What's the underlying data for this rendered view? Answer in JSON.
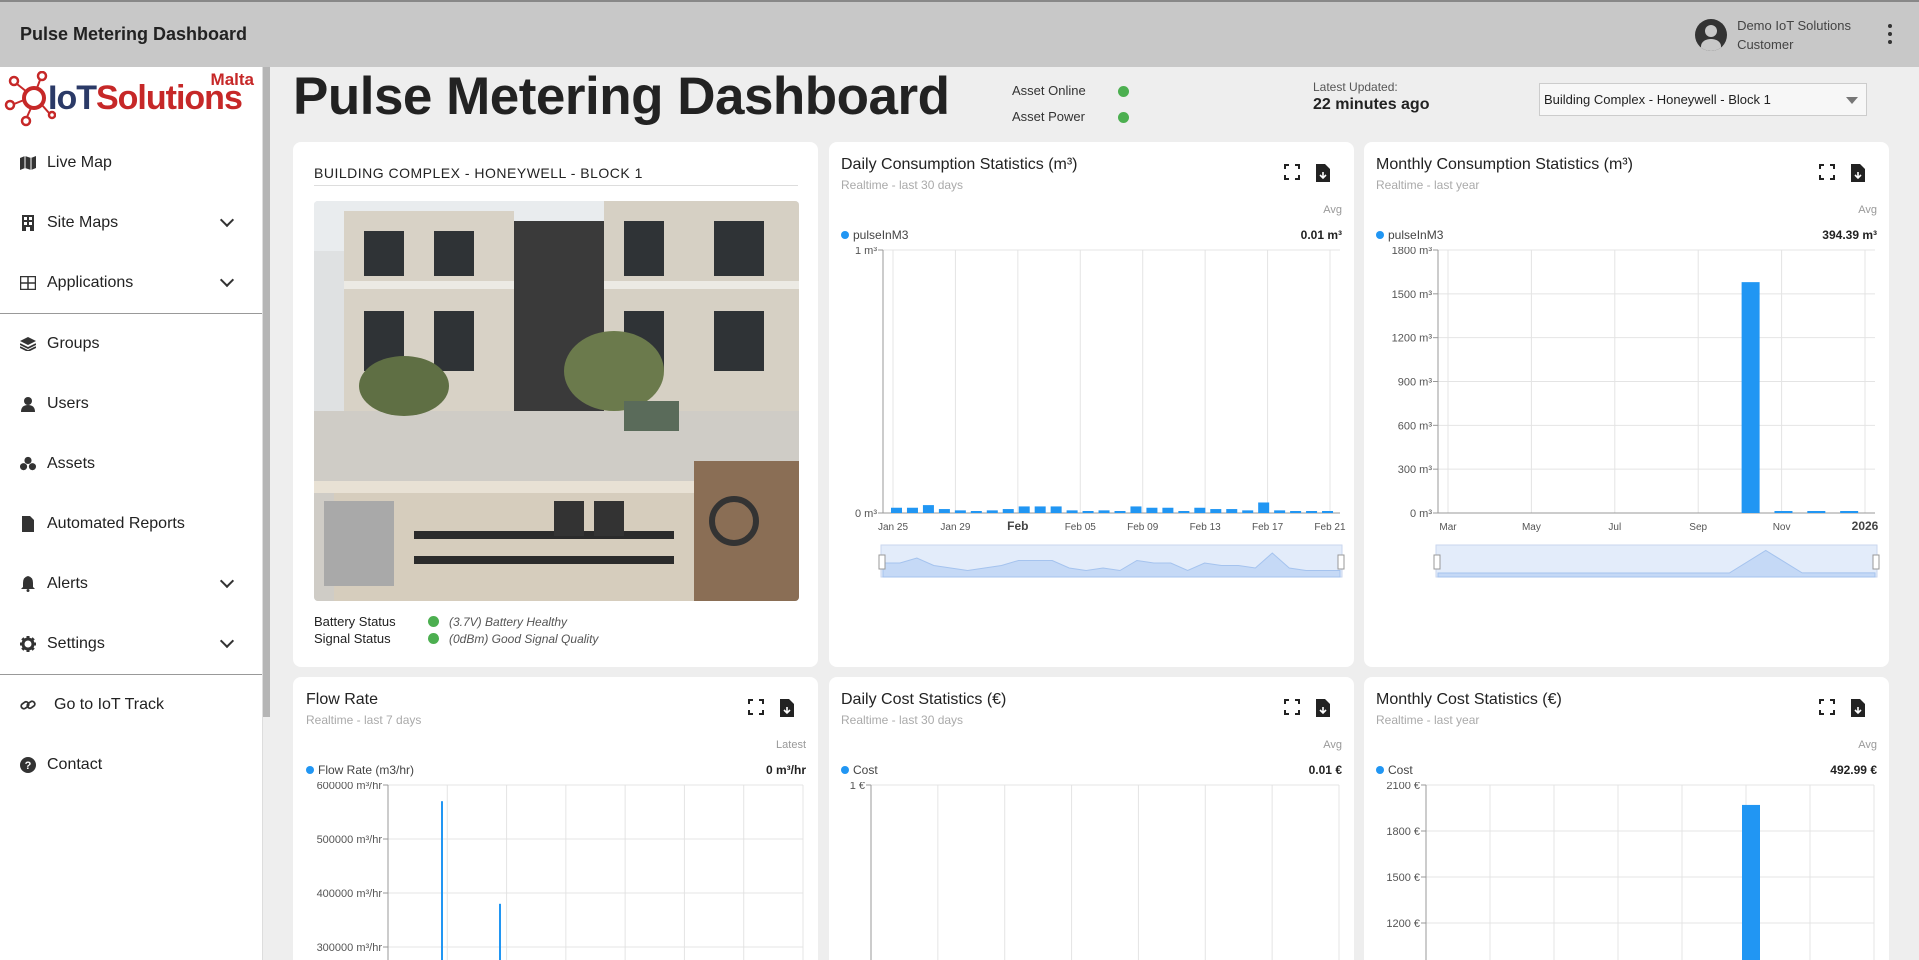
{
  "app": {
    "title": "Pulse Metering Dashboard"
  },
  "user": {
    "name": "Demo IoT Solutions",
    "role": "Customer"
  },
  "logo": {
    "region": "Malta",
    "brand_part1": "IoT",
    "brand_part2": "Solutions"
  },
  "sidebar": {
    "items": [
      {
        "label": "Live Map",
        "icon": "map-icon"
      },
      {
        "label": "Site Maps",
        "icon": "building-icon",
        "expandable": true
      },
      {
        "label": "Applications",
        "icon": "grid-icon",
        "expandable": true
      },
      {
        "label": "Groups",
        "icon": "layers-icon"
      },
      {
        "label": "Users",
        "icon": "user-icon"
      },
      {
        "label": "Assets",
        "icon": "assets-icon"
      },
      {
        "label": "Automated Reports",
        "icon": "file-icon"
      },
      {
        "label": "Alerts",
        "icon": "bell-icon",
        "expandable": true
      },
      {
        "label": "Settings",
        "icon": "gear-icon",
        "expandable": true
      },
      {
        "label": "Go to IoT Track",
        "icon": "link-icon"
      },
      {
        "label": "Contact",
        "icon": "help-icon"
      }
    ]
  },
  "dashboard": {
    "title": "Pulse Metering Dashboard",
    "asset_online_label": "Asset Online",
    "asset_power_label": "Asset Power",
    "latest_label": "Latest Updated:",
    "latest_value": "22 minutes ago",
    "asset_select_value": "Building Complex - Honeywell - Block 1"
  },
  "building_card": {
    "title": "BUILDING COMPLEX - HONEYWELL - BLOCK 1",
    "battery_label": "Battery Status",
    "battery_value": "(3.7V) Battery Healthy",
    "signal_label": "Signal Status",
    "signal_value": "(0dBm) Good Signal Quality"
  },
  "cards": {
    "daily_consumption": {
      "title": "Daily Consumption Statistics (m³)",
      "subtitle": "Realtime - last 30 days",
      "agg": "Avg",
      "series": "pulseInM3",
      "value": "0.01 m³"
    },
    "monthly_consumption": {
      "title": "Monthly Consumption Statistics (m³)",
      "subtitle": "Realtime - last year",
      "agg": "Avg",
      "series": "pulseInM3",
      "value": "394.39 m³"
    },
    "flow_rate": {
      "title": "Flow Rate",
      "subtitle": "Realtime - last 7 days",
      "agg": "Latest",
      "series": "Flow Rate (m3/hr)",
      "value": "0 m³/hr"
    },
    "daily_cost": {
      "title": "Daily Cost Statistics (€)",
      "subtitle": "Realtime - last 30 days",
      "agg": "Avg",
      "series": "Cost",
      "value": "0.01 €"
    },
    "monthly_cost": {
      "title": "Monthly Cost Statistics (€)",
      "subtitle": "Realtime - last year",
      "agg": "Avg",
      "series": "Cost",
      "value": "492.99 €"
    }
  },
  "chart_data": [
    {
      "type": "bar",
      "ylim": [
        0,
        1
      ],
      "yticks": [
        "1 m³",
        "0 m³"
      ],
      "xticks": [
        "Jan 25",
        "Jan 29",
        "Feb",
        "Feb 05",
        "Feb 09",
        "Feb 13",
        "Feb 17",
        "Feb 21"
      ],
      "series": [
        {
          "values": [
            0.02,
            0.02,
            0.03,
            0.015,
            0.01,
            0.005,
            0.01,
            0.015,
            0.025,
            0.025,
            0.025,
            0.01,
            0.005,
            0.01,
            0.005,
            0.025,
            0.02,
            0.02,
            0.005,
            0.02,
            0.015,
            0.015,
            0.01,
            0.04,
            0.01,
            0.005,
            0.005,
            0.005
          ]
        }
      ]
    },
    {
      "type": "bar",
      "ylim": [
        0,
        1800
      ],
      "yticks": [
        "1800 m³",
        "1500 m³",
        "1200 m³",
        "900 m³",
        "600 m³",
        "300 m³",
        "0 m³"
      ],
      "xticks": [
        "Mar",
        "May",
        "Jul",
        "Sep",
        "Nov",
        "2026"
      ],
      "series": [
        {
          "values": [
            0,
            0,
            0,
            0,
            0,
            0,
            0,
            0,
            0,
            1580,
            5,
            5,
            5
          ]
        }
      ]
    },
    {
      "type": "bar",
      "yticks": [
        "600000 m³/hr",
        "500000 m³/hr",
        "400000 m³/hr",
        "300000 m³/hr"
      ],
      "series": [
        {
          "values": [
            570000,
            380000
          ]
        }
      ]
    },
    {
      "type": "bar",
      "yticks": [
        "1 €"
      ]
    },
    {
      "type": "bar",
      "yticks": [
        "2100 €",
        "1800 €",
        "1500 €",
        "1200 €"
      ],
      "series": [
        {
          "values": [
            1970
          ]
        }
      ]
    }
  ],
  "colors": {
    "accent": "#2196f3",
    "online": "#4caf50",
    "brand_red": "#c62828",
    "brand_navy": "#2b3a67"
  }
}
